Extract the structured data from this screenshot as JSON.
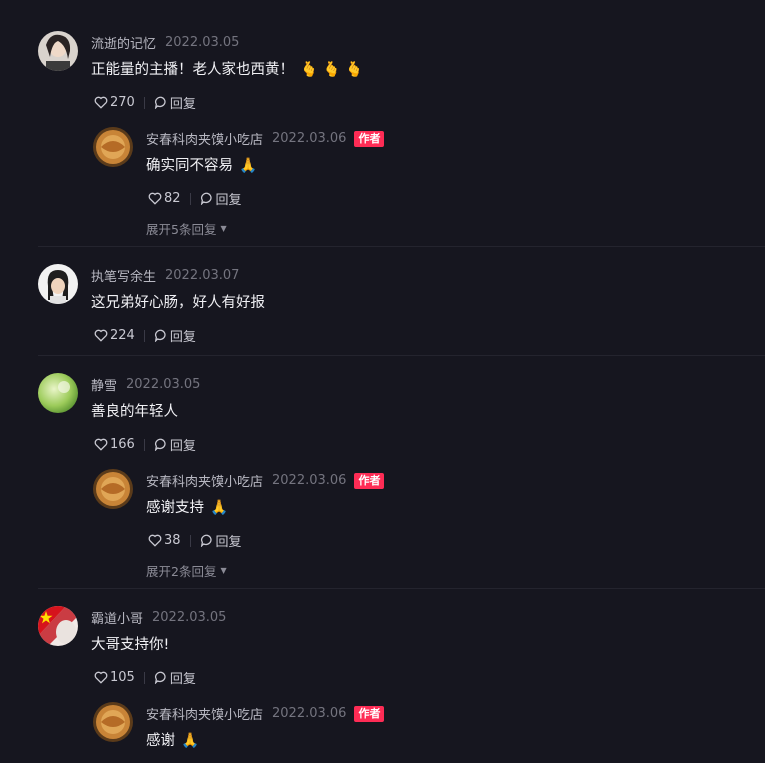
{
  "comments": [
    {
      "user": "流逝的记忆",
      "date": "2022.03.05",
      "text": "正能量的主播！老人家也西黄！",
      "emoji": "🫰 🫰 🫰",
      "likes": "270",
      "reply_label": "回复",
      "reply": {
        "user": "安春科肉夹馍小吃店",
        "date": "2022.03.06",
        "badge": "作者",
        "text": "确实同不容易",
        "emoji": "🙏",
        "likes": "82",
        "reply_label": "回复",
        "expand": "展开5条回复"
      }
    },
    {
      "user": "执笔写余生",
      "date": "2022.03.07",
      "text": "这兄弟好心肠，好人有好报",
      "likes": "224",
      "reply_label": "回复"
    },
    {
      "user": "静雪",
      "date": "2022.03.05",
      "text": "善良的年轻人",
      "likes": "166",
      "reply_label": "回复",
      "reply": {
        "user": "安春科肉夹馍小吃店",
        "date": "2022.03.06",
        "badge": "作者",
        "text": "感谢支持",
        "emoji": "🙏",
        "likes": "38",
        "reply_label": "回复",
        "expand": "展开2条回复"
      }
    },
    {
      "user": "霸道小哥",
      "date": "2022.03.05",
      "text": "大哥支持你!",
      "likes": "105",
      "reply_label": "回复",
      "reply": {
        "user": "安春科肉夹馍小吃店",
        "date": "2022.03.06",
        "badge": "作者",
        "text": "感谢",
        "emoji": "🙏"
      }
    }
  ],
  "colors": {
    "background": "#16161f",
    "badge": "#fe2c55"
  }
}
